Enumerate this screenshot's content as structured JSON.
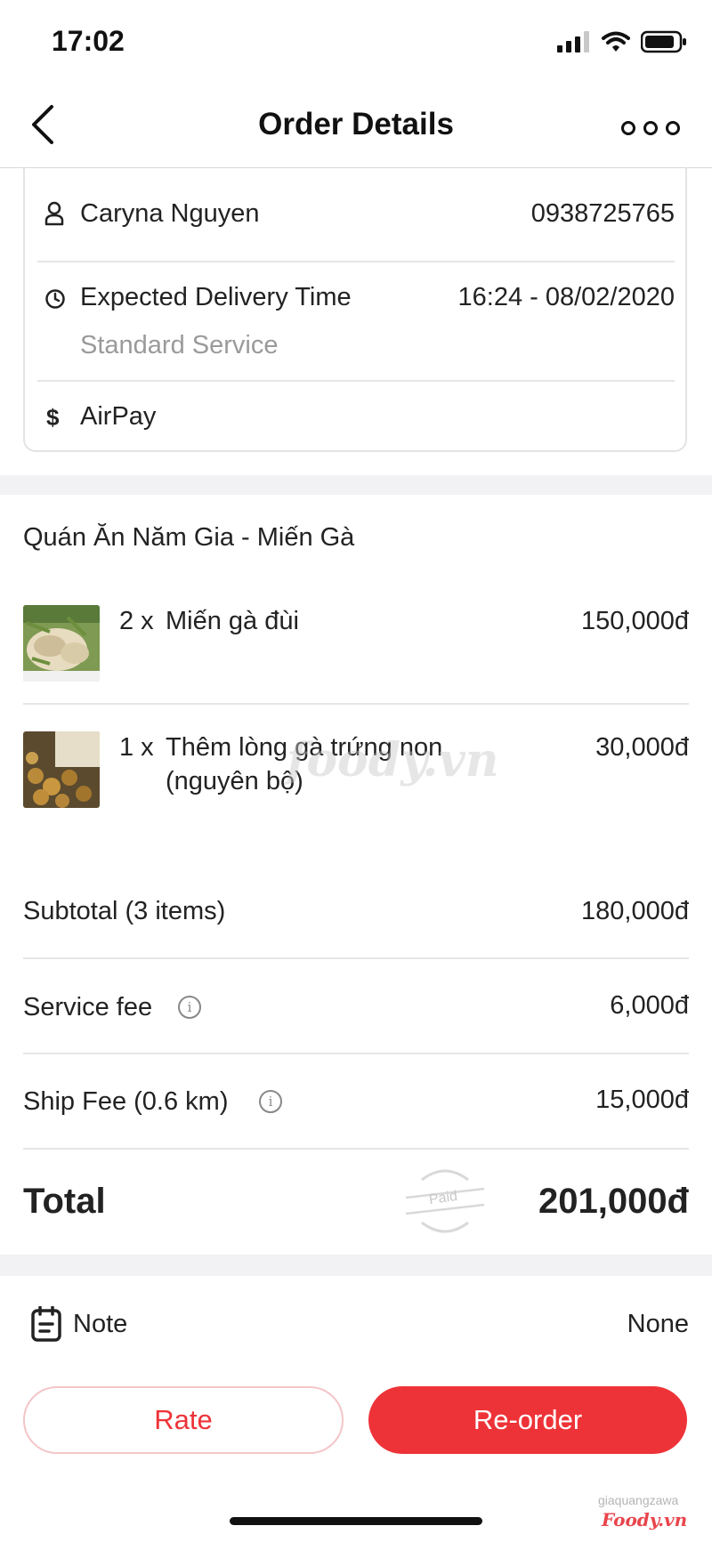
{
  "status_bar": {
    "time": "17:02"
  },
  "header": {
    "title": "Order Details"
  },
  "info": {
    "customer_name": "Caryna Nguyen",
    "phone": "0938725765",
    "delivery_label": "Expected Delivery Time",
    "delivery_time": "16:24 - 08/02/2020",
    "service": "Standard Service",
    "payment_symbol": "$",
    "payment_method": "AirPay"
  },
  "restaurant": {
    "name": "Quán Ăn Năm Gia - Miến Gà"
  },
  "items": [
    {
      "qty": "2 x",
      "name": "Miến gà đùi",
      "name2": "",
      "price": "150,000đ"
    },
    {
      "qty": "1 x",
      "name": "Thêm lòng gà trứng non",
      "name2": "(nguyên bộ)",
      "price": "30,000đ"
    }
  ],
  "summary": {
    "subtotal_label": "Subtotal (3 items)",
    "subtotal_value": "180,000đ",
    "service_label": "Service fee",
    "service_value": "6,000đ",
    "ship_label": "Ship Fee (0.6 km)",
    "ship_value": "15,000đ",
    "total_label": "Total",
    "total_value": "201,000đ",
    "paid_stamp": "Paid",
    "info_glyph": "i"
  },
  "note": {
    "label": "Note",
    "value": "None"
  },
  "actions": {
    "rate_label": "Rate",
    "reorder_label": "Re-order"
  },
  "watermark": {
    "center": "foody.vn",
    "corner_user": "giaquangzawa",
    "corner_brand": "Foody.vn"
  },
  "colors": {
    "accent": "#ee3338",
    "rate_border": "#f3c5c7",
    "band": "#f2f2f5"
  }
}
